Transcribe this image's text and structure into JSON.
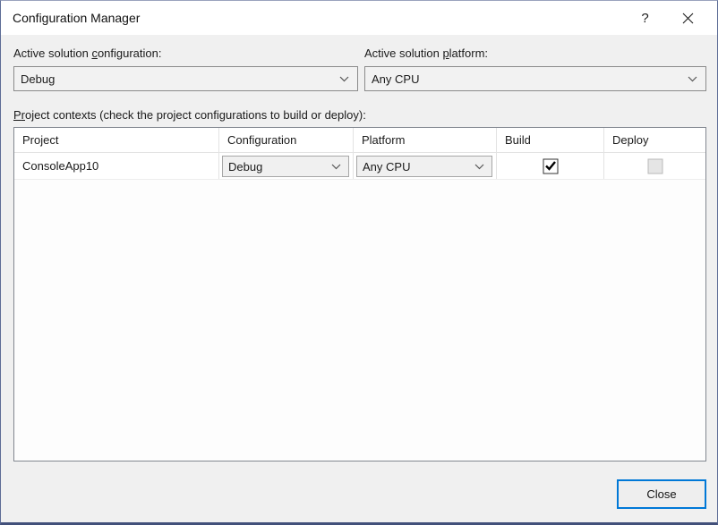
{
  "window": {
    "title": "Configuration Manager",
    "help_label": "?"
  },
  "labels": {
    "active_config": {
      "pre": "Active solution ",
      "u": "c",
      "post": "onfiguration:"
    },
    "active_platform": {
      "pre": "Active solution ",
      "u": "p",
      "post": "latform:"
    },
    "project_contexts": {
      "pre": "P",
      "u": "r",
      "post": "oject contexts (check the project configurations to build or deploy):"
    }
  },
  "combos": {
    "active_configuration": {
      "value": "Debug"
    },
    "active_platform": {
      "value": "Any CPU"
    }
  },
  "table": {
    "columns": [
      "Project",
      "Configuration",
      "Platform",
      "Build",
      "Deploy"
    ],
    "rows": [
      {
        "project": "ConsoleApp10",
        "configuration": "Debug",
        "platform": "Any CPU",
        "build": true,
        "deploy": false
      }
    ]
  },
  "buttons": {
    "close": "Close"
  },
  "colors": {
    "default_button_border": "#0078d7",
    "window_border_bottom": "#42507a",
    "titlebar_bg": "#ffffff",
    "dialog_bg": "#f0f0f0"
  }
}
